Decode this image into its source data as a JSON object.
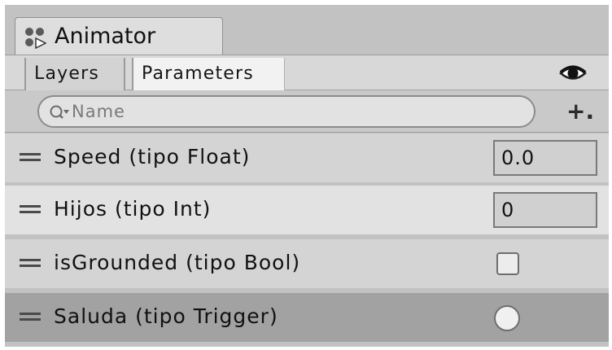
{
  "window": {
    "title": "Animator",
    "title_icon": "animator-icon"
  },
  "tabs": {
    "layers_label": "Layers",
    "parameters_label": "Parameters",
    "active": "Parameters",
    "visibility_icon": "eye-icon"
  },
  "search": {
    "placeholder": "Name",
    "value": "",
    "icon": "search-icon",
    "add_label": "+."
  },
  "parameters": [
    {
      "label": "Speed (tipo Float)",
      "type": "Float",
      "value": "0.0"
    },
    {
      "label": "Hijos (tipo Int)",
      "type": "Int",
      "value": "0"
    },
    {
      "label": "isGrounded (tipo Bool)",
      "type": "Bool",
      "checked": false
    },
    {
      "label": "Saluda (tipo Trigger)",
      "type": "Trigger",
      "selected": true
    }
  ],
  "colors": {
    "row_even": "#d4d4d4",
    "row_odd": "#e2e2e2",
    "row_selected": "#a2a2a2",
    "panel_bg": "#c2c2c2"
  }
}
